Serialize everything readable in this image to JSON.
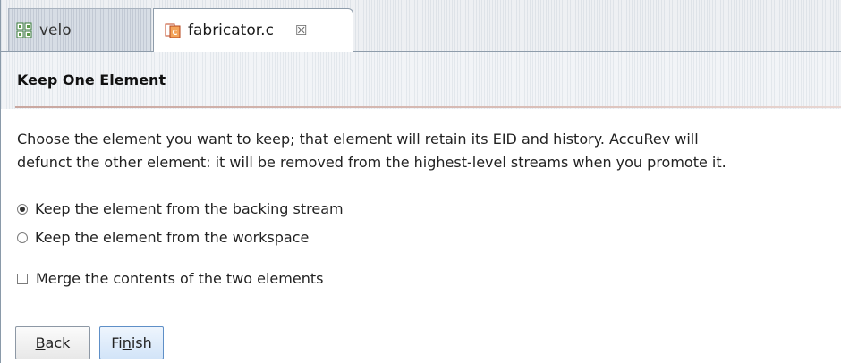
{
  "tabs": [
    {
      "label": "velo",
      "icon": "package-icon",
      "active": false
    },
    {
      "label": "fabricator.c",
      "icon": "c-file-icon",
      "active": true,
      "close_label": "☒"
    }
  ],
  "wizard": {
    "title": "Keep One Element",
    "description_line1": "Choose the element you want to keep; that element will retain its EID and history. AccuRev will",
    "description_line2": "defunct the other element: it will be removed from the highest-level streams when you promote it."
  },
  "options": {
    "radio_backing": {
      "label": "Keep the element from the backing stream",
      "checked": true
    },
    "radio_workspace": {
      "label": "Keep the element from the workspace",
      "checked": false
    },
    "merge_checkbox": {
      "label": "Merge the contents of the two elements",
      "checked": false
    }
  },
  "buttons": {
    "back": {
      "mnemonic": "B",
      "rest": "ack"
    },
    "finish": {
      "prefix": "Fi",
      "mnemonic": "n",
      "rest": "ish"
    }
  },
  "colors": {
    "accent_button_border": "#5e8fc7",
    "separator": "#c9a7a0"
  }
}
